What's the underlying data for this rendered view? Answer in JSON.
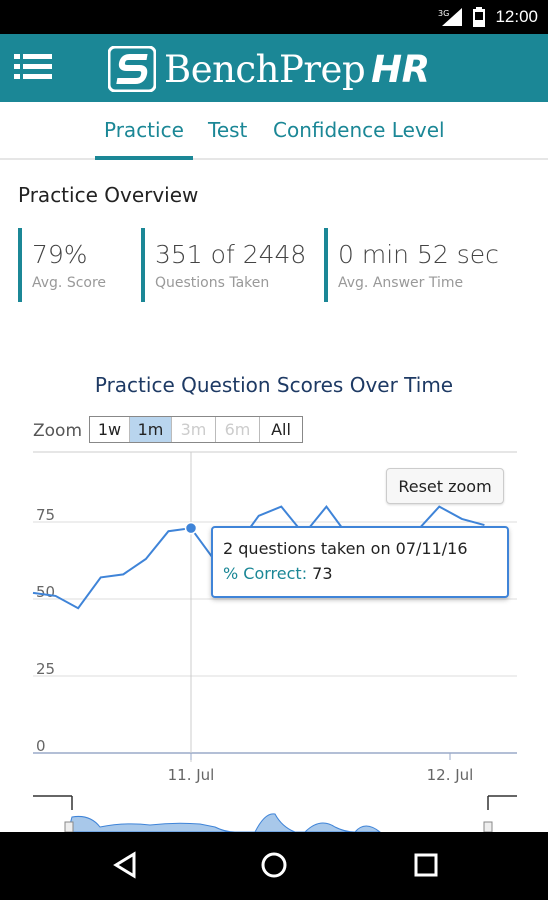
{
  "status_bar": {
    "network": "3G",
    "time": "12:00"
  },
  "app": {
    "brand": "BenchPrep",
    "brand_suffix": "HR",
    "accent": "#1b8796"
  },
  "tabs": [
    {
      "label": "Practice",
      "active": true
    },
    {
      "label": "Test",
      "active": false
    },
    {
      "label": "Confidence Level",
      "active": false
    }
  ],
  "overview": {
    "title": "Practice Overview",
    "stats": [
      {
        "value": "79%",
        "label": "Avg. Score"
      },
      {
        "value": "351 of 2448",
        "label": "Questions Taken"
      },
      {
        "value": "0 min 52 sec",
        "label": "Avg. Answer Time"
      }
    ]
  },
  "chart": {
    "zoom_label": "Zoom",
    "zoom_buttons": [
      {
        "label": "1w",
        "state": "normal"
      },
      {
        "label": "1m",
        "state": "active"
      },
      {
        "label": "3m",
        "state": "disabled"
      },
      {
        "label": "6m",
        "state": "disabled"
      },
      {
        "label": "All",
        "state": "normal"
      }
    ],
    "reset_label": "Reset zoom",
    "tooltip": {
      "line1": "2 questions taken on 07/11/16",
      "key": "% Correct:",
      "value": "73"
    }
  },
  "chart_data": {
    "type": "line",
    "title": "Practice Question Scores Over Time",
    "xlabel": "",
    "ylabel": "",
    "x_ticks": [
      "11. Jul",
      "12. Jul"
    ],
    "y_ticks": [
      0,
      25,
      50,
      75
    ],
    "ylim": [
      0,
      100
    ],
    "grid": true,
    "series": [
      {
        "values": [
          52,
          51,
          47,
          57,
          58,
          63,
          72,
          73,
          63,
          67,
          77,
          80,
          71,
          80,
          70,
          72,
          69,
          72,
          80,
          76,
          74
        ]
      }
    ],
    "highlight": {
      "index": 7,
      "value": 73
    },
    "line_color": "#3f84d8"
  },
  "nav": {
    "back": "back-icon",
    "home": "home-icon",
    "recents": "recents-icon"
  }
}
